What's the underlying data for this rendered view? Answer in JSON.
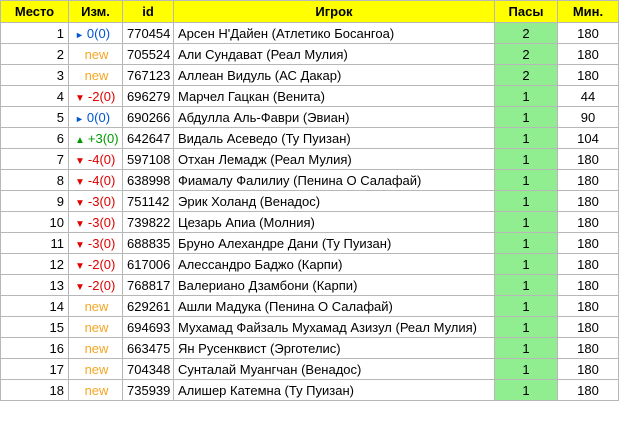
{
  "headers": {
    "place": "Место",
    "change": "Изм.",
    "id": "id",
    "player": "Игрок",
    "passes": "Пасы",
    "minutes": "Мин."
  },
  "colors": {
    "header_bg": "#ffff00",
    "passes_bg": "#90ee90",
    "new": "#f5a623",
    "down": "#e00000",
    "up": "#009900",
    "same": "#0055d4"
  },
  "rows": [
    {
      "place": "1",
      "trend": "same",
      "change": "0(0)",
      "id": "770454",
      "player": "Арсен Н'Дайен (Атлетико Босангоа)",
      "passes": "2",
      "minutes": "180"
    },
    {
      "place": "2",
      "trend": "new",
      "change": "new",
      "id": "705524",
      "player": "Али Сундават (Реал Мулия)",
      "passes": "2",
      "minutes": "180"
    },
    {
      "place": "3",
      "trend": "new",
      "change": "new",
      "id": "767123",
      "player": "Аллеан Видуль (АС Дакар)",
      "passes": "2",
      "minutes": "180"
    },
    {
      "place": "4",
      "trend": "down",
      "change": "-2(0)",
      "id": "696279",
      "player": "Марчел Гацкан (Венита)",
      "passes": "1",
      "minutes": "44"
    },
    {
      "place": "5",
      "trend": "same",
      "change": "0(0)",
      "id": "690266",
      "player": "Абдулла Аль-Фаври (Эвиан)",
      "passes": "1",
      "minutes": "90"
    },
    {
      "place": "6",
      "trend": "up",
      "change": "+3(0)",
      "id": "642647",
      "player": "Видаль Асеведо (Ту Пуизан)",
      "passes": "1",
      "minutes": "104"
    },
    {
      "place": "7",
      "trend": "down",
      "change": "-4(0)",
      "id": "597108",
      "player": "Отхан Лемадж (Реал Мулия)",
      "passes": "1",
      "minutes": "180"
    },
    {
      "place": "8",
      "trend": "down",
      "change": "-4(0)",
      "id": "638998",
      "player": "Фиамалу Фалилиу (Пенина О Салафай)",
      "passes": "1",
      "minutes": "180"
    },
    {
      "place": "9",
      "trend": "down",
      "change": "-3(0)",
      "id": "751142",
      "player": "Эрик Холанд (Венадос)",
      "passes": "1",
      "minutes": "180"
    },
    {
      "place": "10",
      "trend": "down",
      "change": "-3(0)",
      "id": "739822",
      "player": "Цезарь Апиа (Молния)",
      "passes": "1",
      "minutes": "180"
    },
    {
      "place": "11",
      "trend": "down",
      "change": "-3(0)",
      "id": "688835",
      "player": "Бруно Алехандре Дани (Ту Пуизан)",
      "passes": "1",
      "minutes": "180"
    },
    {
      "place": "12",
      "trend": "down",
      "change": "-2(0)",
      "id": "617006",
      "player": "Алессандро Баджо (Карпи)",
      "passes": "1",
      "minutes": "180"
    },
    {
      "place": "13",
      "trend": "down",
      "change": "-2(0)",
      "id": "768817",
      "player": "Валериано Дзамбони (Карпи)",
      "passes": "1",
      "minutes": "180"
    },
    {
      "place": "14",
      "trend": "new",
      "change": "new",
      "id": "629261",
      "player": "Ашли Мадука (Пенина О Салафай)",
      "passes": "1",
      "minutes": "180"
    },
    {
      "place": "15",
      "trend": "new",
      "change": "new",
      "id": "694693",
      "player": "Мухамад Файзаль Мухамад Азизул (Реал Мулия)",
      "passes": "1",
      "minutes": "180"
    },
    {
      "place": "16",
      "trend": "new",
      "change": "new",
      "id": "663475",
      "player": "Ян Русенквист (Эрготелис)",
      "passes": "1",
      "minutes": "180"
    },
    {
      "place": "17",
      "trend": "new",
      "change": "new",
      "id": "704348",
      "player": "Сунталай Муангчан (Венадос)",
      "passes": "1",
      "minutes": "180"
    },
    {
      "place": "18",
      "trend": "new",
      "change": "new",
      "id": "735939",
      "player": "Алишер Катемна (Ту Пуизан)",
      "passes": "1",
      "minutes": "180"
    }
  ]
}
